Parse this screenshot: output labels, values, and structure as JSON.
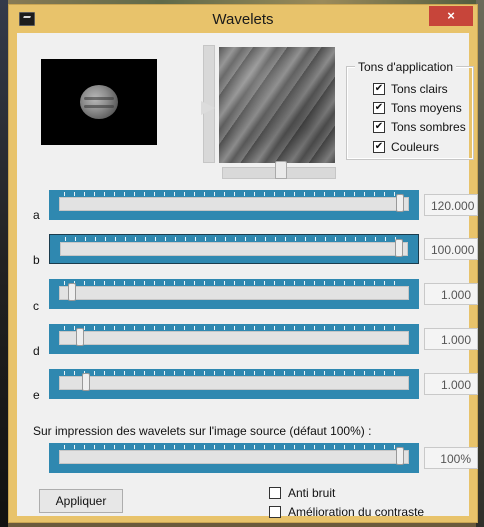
{
  "window": {
    "title": "Wavelets",
    "close_glyph": "×"
  },
  "tones": {
    "title": "Tons d'application",
    "items": [
      {
        "label": "Tons clairs",
        "checked": true
      },
      {
        "label": "Tons moyens",
        "checked": true
      },
      {
        "label": "Tons sombres",
        "checked": true
      },
      {
        "label": "Couleurs",
        "checked": true
      }
    ]
  },
  "sliders": [
    {
      "label": "a",
      "value": "120.000"
    },
    {
      "label": "b",
      "value": "100.000"
    },
    {
      "label": "c",
      "value": "1.000"
    },
    {
      "label": "d",
      "value": "1.000"
    },
    {
      "label": "e",
      "value": "1.000"
    }
  ],
  "overlay": {
    "label": "Sur impression des wavelets sur l'image source (défaut 100%) :",
    "value": "100%"
  },
  "buttons": {
    "apply": "Appliquer"
  },
  "options": {
    "anti_noise": "Anti bruit",
    "contrast": "Amélioration du contraste"
  },
  "colors": {
    "accent": "#2f88b0",
    "title_bar": "#e8c36b",
    "close": "#c7453a"
  }
}
